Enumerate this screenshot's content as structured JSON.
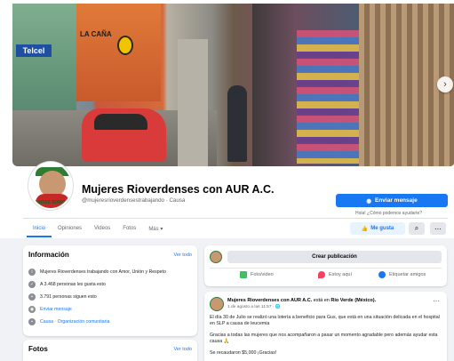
{
  "cover": {
    "signs": {
      "telcel": "Telcel",
      "lacanon": "LA CAÑA"
    }
  },
  "page": {
    "name": "Mujeres Rioverdenses con AUR A.C.",
    "handle": "@mujeresrioverdensestrabajando · Causa",
    "avatar_text": "JUNTAS SOMOS"
  },
  "actions": {
    "send_message": "Enviar mensaje",
    "hint": "Hola! ¿Cómo podemos ayudarte?",
    "like": "Me gusta",
    "search_icon": "search-icon",
    "more_icon": "more-icon"
  },
  "tabs": [
    {
      "label": "Inicio",
      "active": true
    },
    {
      "label": "Opiniones"
    },
    {
      "label": "Videos"
    },
    {
      "label": "Fotos"
    },
    {
      "label": "Más ▾"
    }
  ],
  "info": {
    "title": "Información",
    "see_all": "Ver todo",
    "rows": [
      {
        "icon": "info-icon",
        "text": "Mujeres Rioverdenses trabajando con Amor, Unión y Respeto"
      },
      {
        "icon": "like-icon",
        "text": "A 3.468 personas les gusta esto"
      },
      {
        "icon": "followers-icon",
        "text": "3.791 personas siguen esto"
      },
      {
        "icon": "messenger-icon",
        "text": "Enviar mensaje",
        "link": true
      },
      {
        "icon": "category-icon",
        "text": "Causa · Organización comunitaria",
        "link": true
      }
    ]
  },
  "photos": {
    "title": "Fotos",
    "see_all": "Ver todo"
  },
  "create": {
    "button": "Crear publicación",
    "actions": [
      {
        "label": "Foto/video",
        "color": "#45bd62"
      },
      {
        "label": "Estoy aquí",
        "color": "#f3425f"
      },
      {
        "label": "Etiquetar amigos",
        "color": "#1877f2"
      }
    ]
  },
  "post": {
    "author": "Mujeres Rioverdenses con AUR A.C.",
    "location_prefix": "está en",
    "location": "Río Verde (México).",
    "meta": "1 de agosto a las 11:57 · 🌐",
    "lines": [
      "El día 30 de Julio se realizó una lotería a beneficio para Gus, que está en una situación delicada en el hospital en SLP a causa de leucemia",
      "Gracias a todas las mujeres que nos acompañaron a pasar un momento agradable pero además ayudar esta causa 🙏",
      "Se recaudaron $5,000 ¡Gracias!"
    ]
  }
}
